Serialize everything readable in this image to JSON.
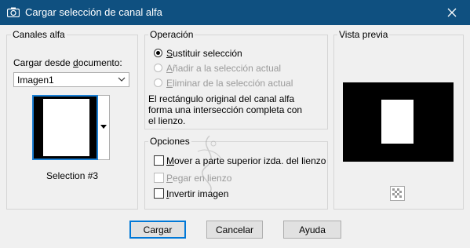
{
  "window": {
    "title": "Cargar selección de canal alfa"
  },
  "canales_alfa": {
    "group_label": "Canales alfa",
    "load_from_label_prefix": "Cargar desde ",
    "load_from_label_access": "d",
    "load_from_label_suffix": "ocumento:",
    "document_value": "Imagen1",
    "selection_caption": "Selection #3"
  },
  "operacion": {
    "group_label": "Operación",
    "options": [
      {
        "access": "S",
        "rest": "ustituir selección",
        "selected": true,
        "enabled": true
      },
      {
        "access": "A",
        "rest": "ñadir a la selección actual",
        "selected": false,
        "enabled": false
      },
      {
        "access": "E",
        "rest": "liminar de la selección actual",
        "selected": false,
        "enabled": false
      }
    ],
    "description_line1": "El rectángulo original del canal alfa",
    "description_line2": "forma una intersección completa con",
    "description_line3": "el lienzo."
  },
  "opciones": {
    "group_label": "Opciones",
    "checks": [
      {
        "access": "M",
        "rest": "over a parte superior izda. del lienzo",
        "checked": false,
        "enabled": true
      },
      {
        "access": "P",
        "rest": "egar en lienzo",
        "checked": false,
        "enabled": false
      },
      {
        "access": "I",
        "rest": "nvertir imagen",
        "checked": false,
        "enabled": true
      }
    ]
  },
  "vista_previa": {
    "group_label": "Vista previa"
  },
  "buttons": {
    "load": "Cargar",
    "cancel": "Cancelar",
    "help": "Ayuda"
  },
  "colors": {
    "titlebar": "#0f5080",
    "focus": "#0078d7"
  },
  "icons": {
    "app": "camera-icon",
    "close": "close-icon",
    "zoom": "checker-zoom-icon"
  }
}
